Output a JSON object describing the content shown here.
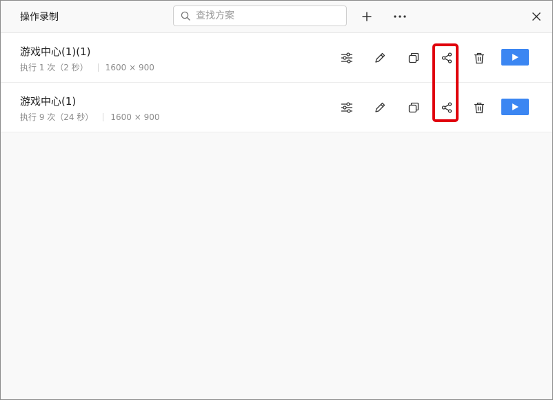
{
  "window": {
    "title": "操作录制",
    "search_placeholder": "查找方案"
  },
  "toolbar": {
    "add_icon": "plus-icon",
    "more_icon": "more-horizontal-icon",
    "close_icon": "close-icon"
  },
  "recordings": [
    {
      "name": "游戏中心(1)(1)",
      "runs": "执行 1 次（2 秒）",
      "resolution": "1600 × 900"
    },
    {
      "name": "游戏中心(1)",
      "runs": "执行 9 次（24 秒）",
      "resolution": "1600 × 900"
    }
  ],
  "row_actions": [
    "settings-icon",
    "edit-icon",
    "copy-icon",
    "share-icon",
    "delete-icon",
    "play-icon"
  ],
  "colors": {
    "accent": "#3b86f2",
    "highlight": "#e0000c"
  }
}
